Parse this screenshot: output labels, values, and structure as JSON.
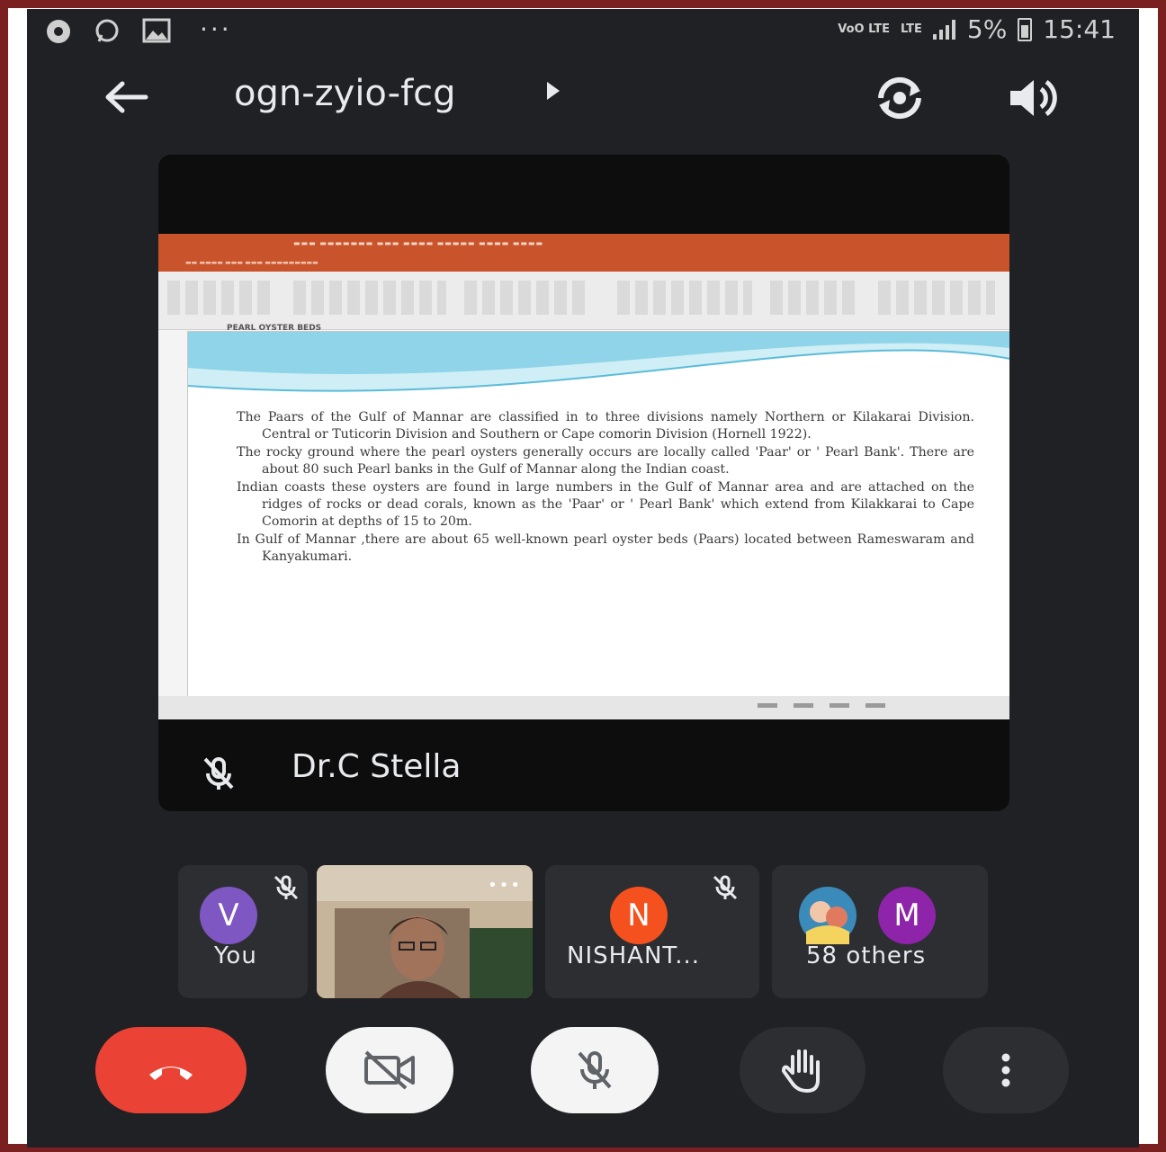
{
  "status_bar": {
    "left_icons": [
      "chrome-icon",
      "whatsapp-icon",
      "image-icon",
      "more-dots-icon"
    ],
    "network_1": "VoO LTE",
    "network_2": "LTE",
    "battery": "5%",
    "time": "15:41"
  },
  "top_bar": {
    "meeting_code": "ogn-zyio-fcg"
  },
  "main_tile": {
    "presenter_name": "Dr.C Stella",
    "slide": {
      "heading": "PEARL OYSTER BEDS",
      "paragraphs": [
        "The Paars of the Gulf of Mannar are classified in to three divisions namely Northern or Kilakarai Division. Central or Tuticorin Division and Southern or Cape comorin Division (Hornell 1922).",
        "The rocky ground where the pearl oysters generally occurs are locally called 'Paar' or ' Pearl Bank'. There are about 80 such Pearl banks in the Gulf of Mannar along the Indian coast.",
        "Indian coasts these oysters are found in large numbers in the Gulf of Mannar area and are attached on the ridges of rocks or dead corals, known as the 'Paar' or ' Pearl Bank' which extend from Kilakkarai to Cape Comorin at depths of 15 to 20m.",
        "In Gulf of Mannar ,there are about 65 well-known pearl oyster beds (Paars) located between Rameswaram and Kanyakumari."
      ]
    }
  },
  "participants": [
    {
      "initial": "V",
      "label": "You",
      "color": "#7e57c2",
      "muted": true
    },
    {
      "label": "",
      "video": true
    },
    {
      "initial": "N",
      "label": "NISHANT...",
      "color": "#f4511e",
      "muted": true
    },
    {
      "initial": "M",
      "label": "58 others",
      "color": "#8e24aa"
    }
  ],
  "colors": {
    "end_call": "#ea4335",
    "background": "#202124",
    "tile": "#2d2e31",
    "frame": "#7b2020"
  }
}
